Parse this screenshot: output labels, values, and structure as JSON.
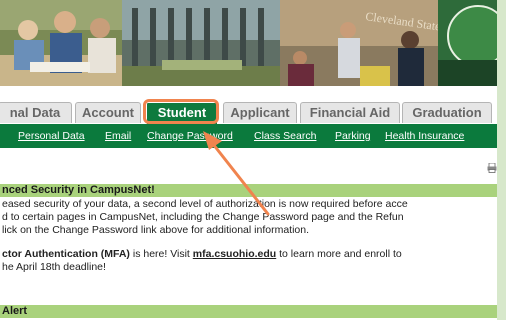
{
  "tabs": [
    {
      "label": "nal Data",
      "active": false
    },
    {
      "label": "Account",
      "active": false
    },
    {
      "label": "Student",
      "active": true
    },
    {
      "label": "Applicant",
      "active": false
    },
    {
      "label": "Financial Aid",
      "active": false
    },
    {
      "label": "Graduation",
      "active": false
    }
  ],
  "subnav": [
    "Personal Data",
    "Email",
    "Change Password",
    "Class Search",
    "Parking",
    "Health Insurance"
  ],
  "security_section": {
    "heading": "nced Security in CampusNet!",
    "line1": "eased security of your data, a second level of authorization is now required before acce",
    "line2": "d to certain pages in CampusNet, including the Change Password page and the Refun",
    "line3": "lick on the Change Password link above for additional information.",
    "mfa_bold": "ctor Authentication (MFA)",
    "mfa_text": " is here! Visit ",
    "mfa_link": "mfa.csuohio.edu",
    "mfa_text2": " to learn more and enroll to",
    "line5": "he April 18th deadline!"
  },
  "alert_section": {
    "heading": "Alert"
  },
  "banner_sign": "Cleveland State",
  "colors": {
    "accent_green": "#0b7a3d",
    "section_green": "#a9d27c",
    "highlight": "#f0844e"
  }
}
